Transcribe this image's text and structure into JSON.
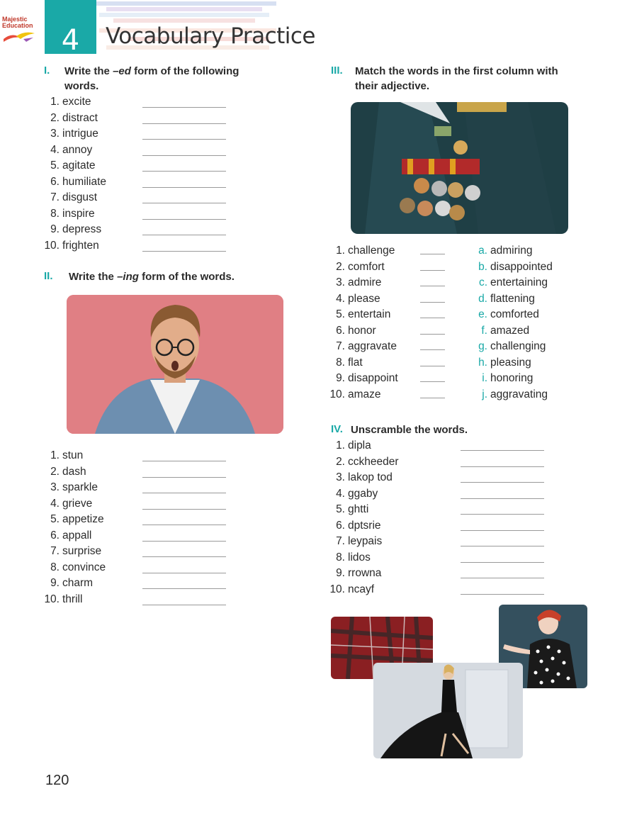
{
  "header": {
    "unit_number": "4",
    "title": "Vocabulary Practice",
    "logo_text_1": "Majestic",
    "logo_text_2": "Education"
  },
  "section1": {
    "num": "I.",
    "heading_pre": "Write the ",
    "heading_em": "–ed",
    "heading_post": " form of the following",
    "heading_line2": "words.",
    "items": [
      "excite",
      "distract",
      "intrigue",
      "annoy",
      "agitate",
      "humiliate",
      "disgust",
      "inspire",
      "depress",
      "frighten"
    ]
  },
  "section2": {
    "num": "II.",
    "heading_pre": "Write the ",
    "heading_em": "–ing",
    "heading_post": " form of the words.",
    "items": [
      "stun",
      "dash",
      "sparkle",
      "grieve",
      "appetize",
      "appall",
      "surprise",
      "convince",
      "charm",
      "thrill"
    ]
  },
  "section3": {
    "num": "III.",
    "heading_line1": "Match the words in the first column with",
    "heading_line2": "their adjective.",
    "items": [
      "challenge",
      "comfort",
      "admire",
      "please",
      "entertain",
      "honor",
      "aggravate",
      "flat",
      "disappoint",
      "amaze"
    ],
    "letters": [
      "a.",
      "b.",
      "c.",
      "d.",
      "e.",
      "f.",
      "g.",
      "h.",
      "i.",
      "j."
    ],
    "options": [
      "admiring",
      "disappointed",
      "entertaining",
      "flattening",
      "comforted",
      "amazed",
      "challenging",
      "pleasing",
      "honoring",
      "aggravating"
    ]
  },
  "section4": {
    "num": "IV.",
    "heading": "Unscramble the words.",
    "items": [
      "dipla",
      "cckheeder",
      "lakop tod",
      "ggaby",
      "ghtti",
      "dptsrie",
      "leypais",
      "lidos",
      "rrowna",
      "ncayf"
    ]
  },
  "numbers": [
    "1.",
    "2.",
    "3.",
    "4.",
    "5.",
    "6.",
    "7.",
    "8.",
    "9.",
    "10."
  ],
  "page_number": "120",
  "colors": {
    "accent": "#1aa9a7",
    "text": "#2b2b2b"
  }
}
